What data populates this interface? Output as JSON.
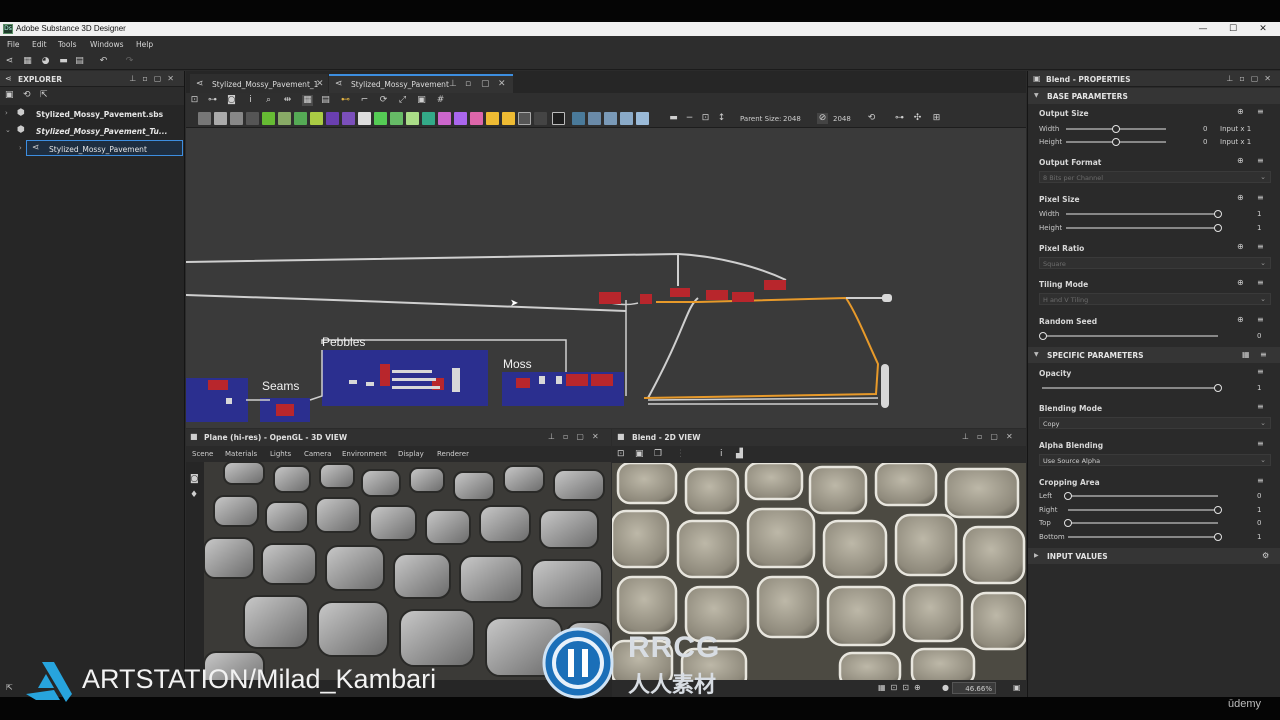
{
  "window": {
    "title": "Adobe Substance 3D Designer",
    "app_icon_text": "Ds",
    "minimize": "—",
    "maximize": "☐",
    "close": "✕"
  },
  "menu": [
    "File",
    "Edit",
    "Tools",
    "Windows",
    "Help"
  ],
  "explorer": {
    "title": "EXPLORER",
    "items": [
      {
        "label": "Stylized_Mossy_Pavement.sbs",
        "expanded": false
      },
      {
        "label": "Stylized_Mossy_Pavement_Tu...",
        "expanded": true
      },
      {
        "label": "Stylized_Mossy_Pavement",
        "selected": true
      }
    ]
  },
  "graph": {
    "tabs": [
      {
        "label": "Stylized_Mossy_Pavement_1",
        "active": false
      },
      {
        "label": "Stylized_Mossy_Pavement",
        "active": true
      }
    ],
    "parent_size_label": "Parent Size:",
    "parent_size_value": "2048",
    "size_value": "2048",
    "frames": [
      {
        "label": "Seams"
      },
      {
        "label": "Pebbles"
      },
      {
        "label": "Moss"
      }
    ]
  },
  "view3d": {
    "title": "Plane (hi-res) - OpenGL - 3D VIEW",
    "menu": [
      "Scene",
      "Materials",
      "Lights",
      "Camera",
      "Environment",
      "Display",
      "Renderer"
    ]
  },
  "view2d": {
    "title": "Blend - 2D VIEW",
    "zoom": "46.66%"
  },
  "properties": {
    "title": "Blend - PROPERTIES",
    "base_section": "BASE PARAMETERS",
    "output_size": {
      "label": "Output Size",
      "width_label": "Width",
      "width_value": "0",
      "width_rel": "Input x 1",
      "height_label": "Height",
      "height_value": "0",
      "height_rel": "Input x 1"
    },
    "output_format": {
      "label": "Output Format",
      "value": "8 Bits per Channel"
    },
    "pixel_size": {
      "label": "Pixel Size",
      "width_label": "Width",
      "width_value": "1",
      "height_label": "Height",
      "height_value": "1"
    },
    "pixel_ratio": {
      "label": "Pixel Ratio",
      "value": "Square"
    },
    "tiling_mode": {
      "label": "Tiling Mode",
      "value": "H and V Tiling"
    },
    "random_seed": {
      "label": "Random Seed",
      "value": "0"
    },
    "specific_section": "SPECIFIC PARAMETERS",
    "opacity": {
      "label": "Opacity",
      "value": "1"
    },
    "blending_mode": {
      "label": "Blending Mode",
      "value": "Copy"
    },
    "alpha_blending": {
      "label": "Alpha Blending",
      "value": "Use Source Alpha"
    },
    "cropping": {
      "label": "Cropping Area",
      "left_label": "Left",
      "left_value": "0",
      "right_label": "Right",
      "right_value": "1",
      "top_label": "Top",
      "top_value": "0",
      "bottom_label": "Bottom",
      "bottom_value": "1"
    },
    "input_section": "INPUT VALUES"
  },
  "overlay": {
    "artstation": "ARTSTATION/Milad_Kambari",
    "rrcg_latin": "RRCG",
    "rrcg_cjk": "人人素材",
    "udemy": "ūdemy"
  },
  "colors": {
    "accent": "#3d8ee0",
    "frame_fill": "#2b2f8f",
    "orange_wire": "#e89a2a",
    "node_red": "#b8262c"
  }
}
